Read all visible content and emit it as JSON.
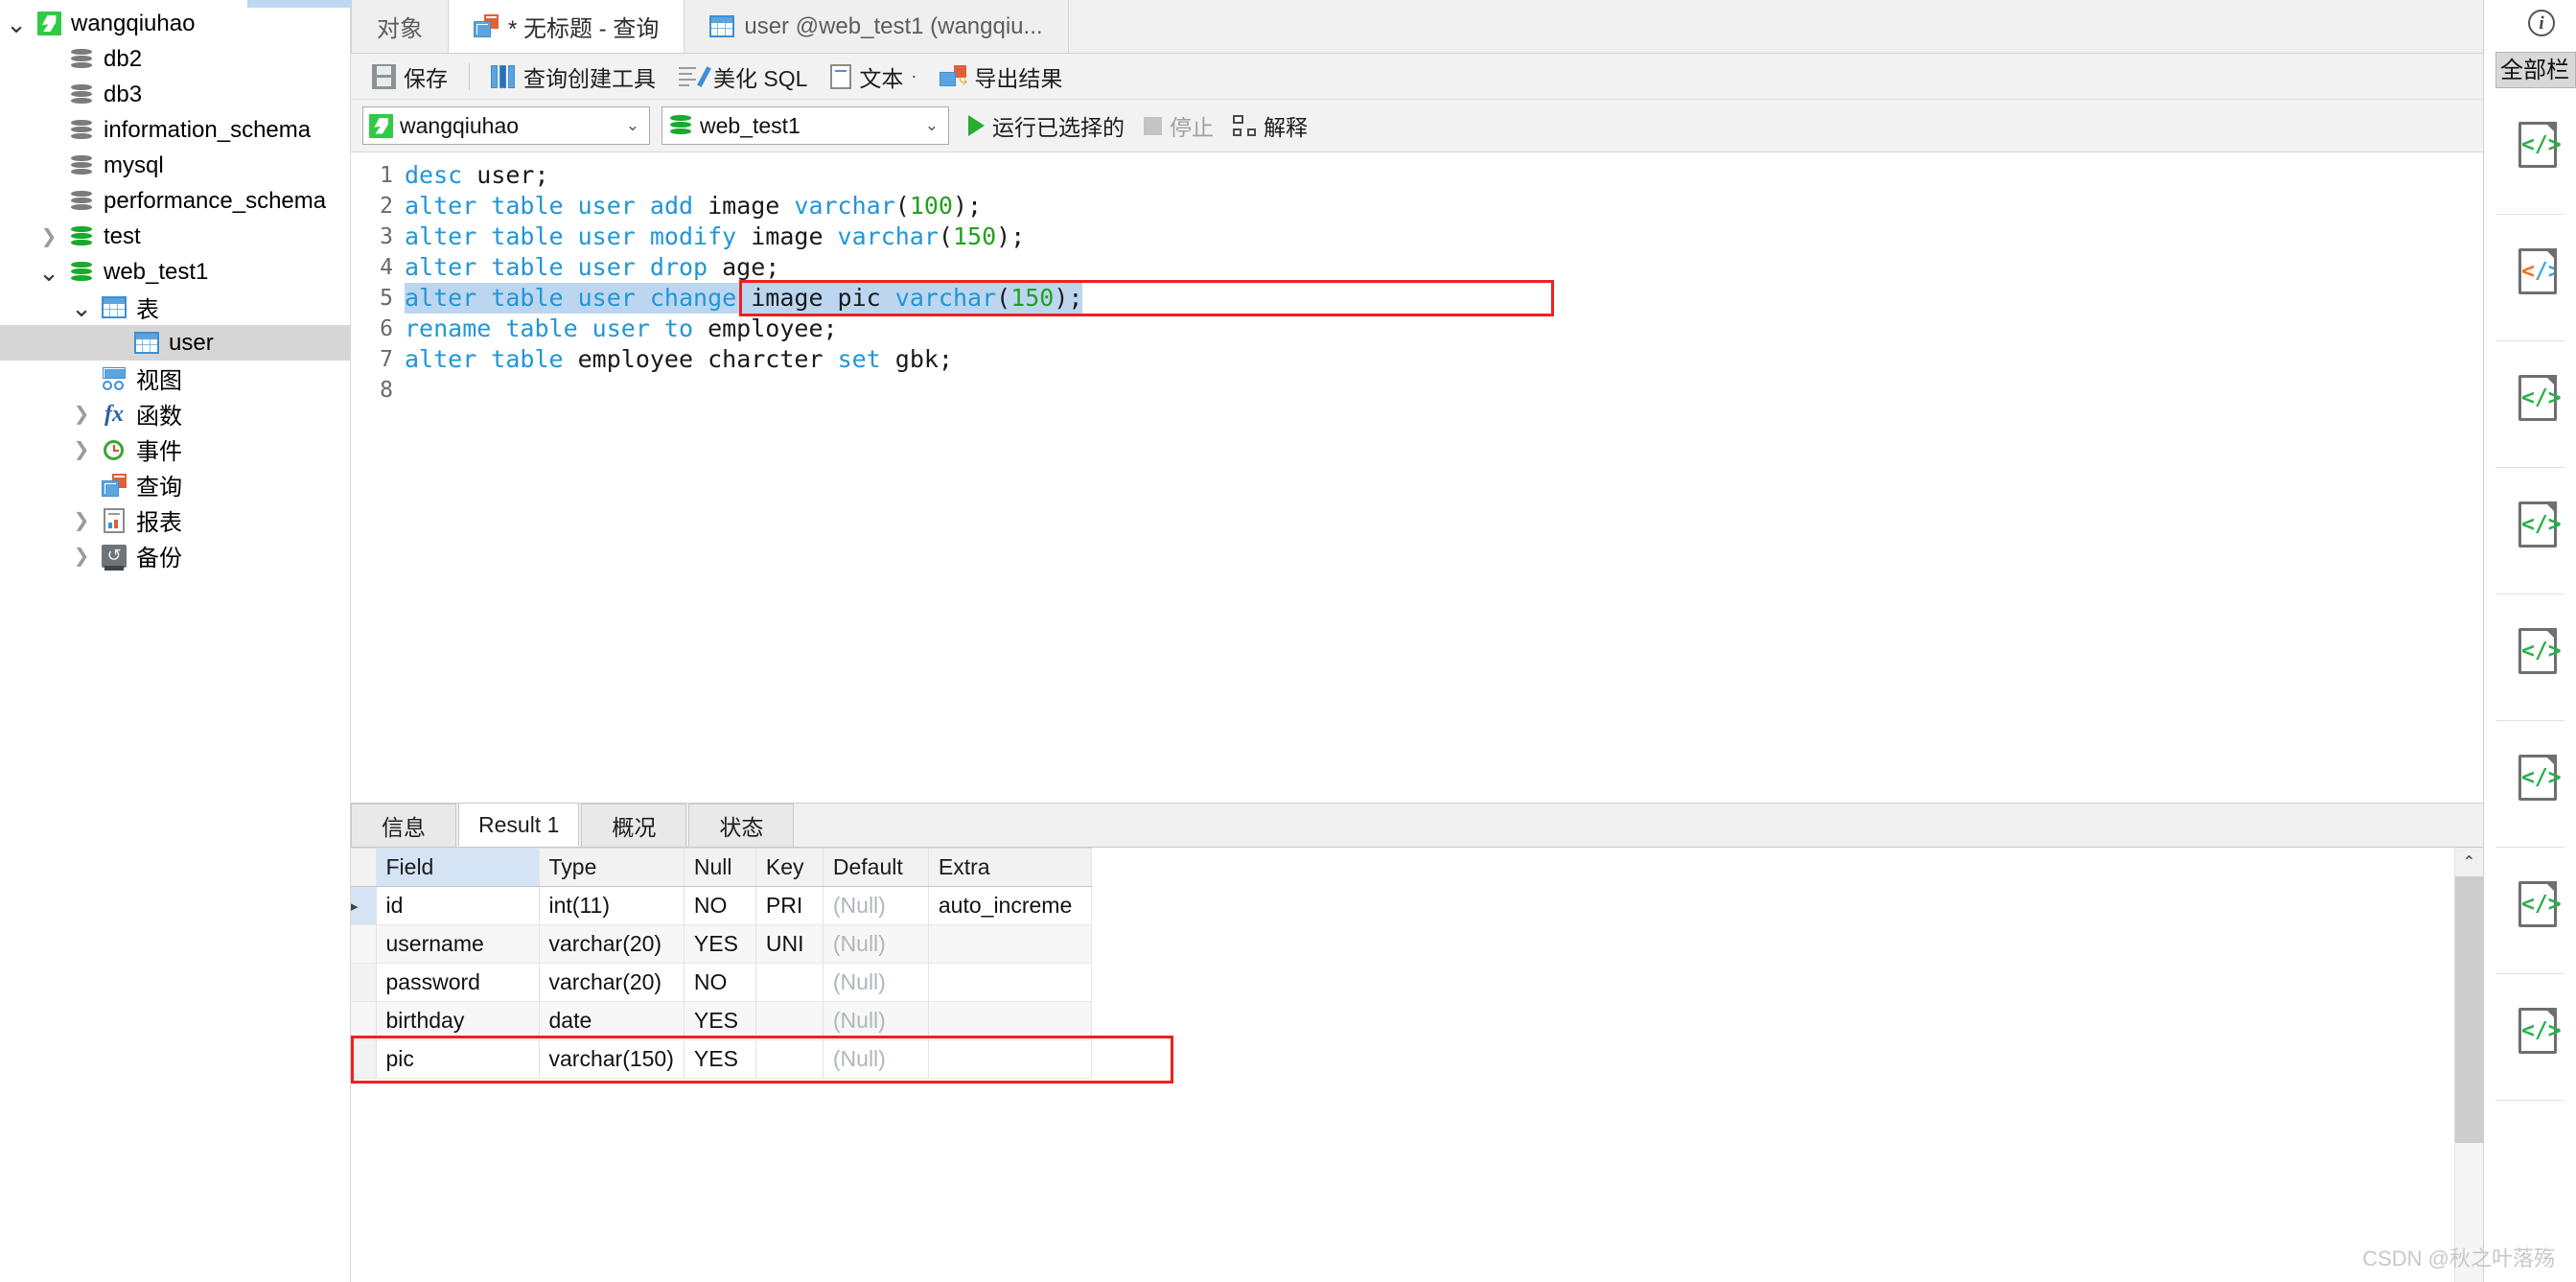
{
  "sidebar": {
    "items": [
      {
        "label": "wangqiuhao",
        "icon": "connection-icon",
        "indent": 0,
        "twisty": "down-open",
        "selected": false
      },
      {
        "label": "db2",
        "icon": "database-gray-icon",
        "indent": 1,
        "twisty": "none",
        "selected": false
      },
      {
        "label": "db3",
        "icon": "database-gray-icon",
        "indent": 1,
        "twisty": "none",
        "selected": false
      },
      {
        "label": "information_schema",
        "icon": "database-gray-icon",
        "indent": 1,
        "twisty": "none",
        "selected": false
      },
      {
        "label": "mysql",
        "icon": "database-gray-icon",
        "indent": 1,
        "twisty": "none",
        "selected": false
      },
      {
        "label": "performance_schema",
        "icon": "database-gray-icon",
        "indent": 1,
        "twisty": "none",
        "selected": false
      },
      {
        "label": "test",
        "icon": "database-green-icon",
        "indent": 1,
        "twisty": "right",
        "selected": false
      },
      {
        "label": "web_test1",
        "icon": "database-green-icon",
        "indent": 1,
        "twisty": "down",
        "selected": false
      },
      {
        "label": "表",
        "icon": "table-icon",
        "indent": 2,
        "twisty": "down",
        "selected": false
      },
      {
        "label": "user",
        "icon": "table-icon",
        "indent": 3,
        "twisty": "none",
        "selected": true
      },
      {
        "label": "视图",
        "icon": "view-icon",
        "indent": 2,
        "twisty": "none",
        "selected": false
      },
      {
        "label": "函数",
        "icon": "function-icon",
        "indent": 2,
        "twisty": "right",
        "selected": false
      },
      {
        "label": "事件",
        "icon": "event-icon",
        "indent": 2,
        "twisty": "right",
        "selected": false
      },
      {
        "label": "查询",
        "icon": "query-icon",
        "indent": 2,
        "twisty": "none",
        "selected": false
      },
      {
        "label": "报表",
        "icon": "report-icon",
        "indent": 2,
        "twisty": "right",
        "selected": false
      },
      {
        "label": "备份",
        "icon": "backup-icon",
        "indent": 2,
        "twisty": "right",
        "selected": false
      }
    ]
  },
  "tabs": [
    {
      "label": "对象",
      "icon": "none",
      "active": false
    },
    {
      "label": "* 无标题 - 查询",
      "icon": "query-icon",
      "active": true
    },
    {
      "label": "user @web_test1 (wangqiu...",
      "icon": "table-icon",
      "active": false
    }
  ],
  "toolbar": {
    "save_label": "保存",
    "builder_label": "查询创建工具",
    "beautify_label": "美化 SQL",
    "text_label": "文本",
    "text_caret": "·",
    "export_label": "导出结果"
  },
  "connbar": {
    "connection_value": "wangqiuhao",
    "database_value": "web_test1",
    "run_label": "运行已选择的",
    "stop_label": "停止",
    "explain_label": "解释"
  },
  "editor": {
    "lines": [
      {
        "n": "1",
        "tokens": [
          {
            "t": "desc",
            "c": "kw"
          },
          {
            "t": " user;",
            "c": "pl"
          }
        ],
        "highlighted": false
      },
      {
        "n": "2",
        "tokens": [
          {
            "t": "alter table user",
            "c": "kw"
          },
          {
            "t": " ",
            "c": "pl"
          },
          {
            "t": "add",
            "c": "kw"
          },
          {
            "t": " image ",
            "c": "pl"
          },
          {
            "t": "varchar",
            "c": "kw"
          },
          {
            "t": "(",
            "c": "pl"
          },
          {
            "t": "100",
            "c": "num"
          },
          {
            "t": ");",
            "c": "pl"
          }
        ],
        "highlighted": false
      },
      {
        "n": "3",
        "tokens": [
          {
            "t": "alter table user modify",
            "c": "kw"
          },
          {
            "t": " image ",
            "c": "pl"
          },
          {
            "t": "varchar",
            "c": "kw"
          },
          {
            "t": "(",
            "c": "pl"
          },
          {
            "t": "150",
            "c": "num"
          },
          {
            "t": ");",
            "c": "pl"
          }
        ],
        "highlighted": false
      },
      {
        "n": "4",
        "tokens": [
          {
            "t": "alter table user drop",
            "c": "kw"
          },
          {
            "t": " age;",
            "c": "pl"
          }
        ],
        "highlighted": false
      },
      {
        "n": "5",
        "tokens": [
          {
            "t": "alter table user change",
            "c": "kw"
          },
          {
            "t": " image pic ",
            "c": "pl"
          },
          {
            "t": "varchar",
            "c": "kw"
          },
          {
            "t": "(",
            "c": "pl"
          },
          {
            "t": "150",
            "c": "num"
          },
          {
            "t": ");",
            "c": "pl"
          }
        ],
        "highlighted": true
      },
      {
        "n": "6",
        "tokens": [
          {
            "t": "rename table user to",
            "c": "kw"
          },
          {
            "t": " employee;",
            "c": "pl"
          }
        ],
        "highlighted": false
      },
      {
        "n": "7",
        "tokens": [
          {
            "t": "alter table",
            "c": "kw"
          },
          {
            "t": " employee charcter ",
            "c": "pl"
          },
          {
            "t": "set",
            "c": "kw"
          },
          {
            "t": " gbk;",
            "c": "pl"
          }
        ],
        "highlighted": false
      },
      {
        "n": "8",
        "tokens": [
          {
            "t": "",
            "c": "pl"
          }
        ],
        "highlighted": false
      }
    ],
    "annotation_color": "#f02020"
  },
  "result_tabs": [
    {
      "label": "信息",
      "active": false
    },
    {
      "label": "Result 1",
      "active": true
    },
    {
      "label": "概况",
      "active": false
    },
    {
      "label": "状态",
      "active": false
    }
  ],
  "grid": {
    "columns": [
      "Field",
      "Type",
      "Null",
      "Key",
      "Default",
      "Extra"
    ],
    "rows": [
      {
        "current": true,
        "highlighted": false,
        "cells": [
          "id",
          "int(11)",
          "NO",
          "PRI",
          "(Null)",
          "auto_increme"
        ]
      },
      {
        "current": false,
        "highlighted": false,
        "cells": [
          "username",
          "varchar(20)",
          "YES",
          "UNI",
          "(Null)",
          ""
        ]
      },
      {
        "current": false,
        "highlighted": false,
        "cells": [
          "password",
          "varchar(20)",
          "NO",
          "",
          "(Null)",
          ""
        ]
      },
      {
        "current": false,
        "highlighted": false,
        "cells": [
          "birthday",
          "date",
          "YES",
          "",
          "(Null)",
          ""
        ]
      },
      {
        "current": false,
        "highlighted": true,
        "cells": [
          "pic",
          "varchar(150)",
          "YES",
          "",
          "(Null)",
          ""
        ]
      }
    ],
    "null_token": "(Null)",
    "highlight_color": "#f02020"
  },
  "right_dock": {
    "info_glyph": "i",
    "all_columns_label": "全部栏",
    "files": [
      {
        "icon": "code-file-green-icon"
      },
      {
        "icon": "code-file-color-icon"
      },
      {
        "icon": "code-file-green-icon"
      },
      {
        "icon": "code-file-green-icon"
      },
      {
        "icon": "code-file-green-icon"
      },
      {
        "icon": "code-file-green-icon"
      },
      {
        "icon": "code-file-green-icon"
      },
      {
        "icon": "code-file-green-icon"
      }
    ]
  },
  "watermark": "CSDN @秋之叶落殇"
}
